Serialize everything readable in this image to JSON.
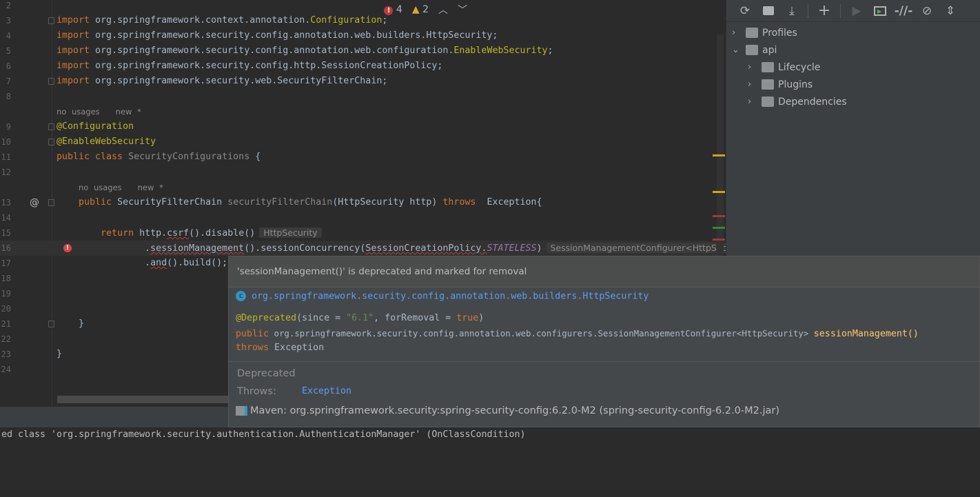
{
  "editor": {
    "lines": [
      {
        "n": "2",
        "tokens": []
      },
      {
        "n": "3",
        "fold": true,
        "tokens": [
          [
            "kw",
            "import "
          ],
          [
            "pl",
            "org.springframework.context.annotation."
          ],
          [
            "an",
            "Configuration"
          ],
          [
            "pl",
            ";"
          ]
        ]
      },
      {
        "n": "4",
        "tokens": [
          [
            "kw",
            "import "
          ],
          [
            "pl",
            "org.springframework.security.config.annotation.web.builders.HttpSecurity;"
          ]
        ]
      },
      {
        "n": "5",
        "tokens": [
          [
            "kw",
            "import "
          ],
          [
            "pl",
            "org.springframework.security.config.annotation.web.configuration."
          ],
          [
            "an",
            "EnableWebSecurity"
          ],
          [
            "pl",
            ";"
          ]
        ]
      },
      {
        "n": "6",
        "tokens": [
          [
            "kw",
            "import "
          ],
          [
            "pl",
            "org.springframework.security.config.http.SessionCreationPolicy;"
          ]
        ]
      },
      {
        "n": "7",
        "fold": true,
        "tokens": [
          [
            "kw",
            "import "
          ],
          [
            "pl",
            "org.springframework.security.web.SecurityFilterChain;"
          ]
        ]
      },
      {
        "n": "8",
        "tokens": []
      },
      {
        "inlay": "no usages   new *",
        "indent": 0
      },
      {
        "n": "9",
        "fold": true,
        "tokens": [
          [
            "an",
            "@Configuration"
          ]
        ]
      },
      {
        "n": "10",
        "fold": true,
        "tokens": [
          [
            "an",
            "@EnableWebSecurity"
          ]
        ]
      },
      {
        "n": "11",
        "tokens": [
          [
            "kw",
            "public class "
          ],
          [
            "gr",
            "SecurityConfigurations"
          ],
          [
            "pl",
            " {"
          ]
        ]
      },
      {
        "n": "12",
        "tokens": []
      },
      {
        "inlay": "no usages   new *",
        "indent": 4
      },
      {
        "n": "13",
        "fold": true,
        "gutter": "@",
        "tokens": [
          [
            "pl",
            "    "
          ],
          [
            "kw",
            "public "
          ],
          [
            "pl",
            "SecurityFilterChain "
          ],
          [
            "gr",
            "securityFilterChain"
          ],
          [
            "pl",
            "(HttpSecurity http) "
          ],
          [
            "kw",
            "throws "
          ],
          [
            "pl",
            " Exception{"
          ]
        ]
      },
      {
        "n": "14",
        "tokens": []
      },
      {
        "n": "15",
        "tokens": [
          [
            "pl",
            "        "
          ],
          [
            "kw",
            "return "
          ],
          [
            "pl",
            "http."
          ],
          [
            "err",
            "csrf"
          ],
          [
            "pl",
            "().disable()"
          ],
          [
            "hint",
            "HttpSecurity"
          ]
        ]
      },
      {
        "n": "16",
        "current": true,
        "bulb": true,
        "tokens": [
          [
            "pl",
            "                ."
          ],
          [
            "err",
            "sessionManagement"
          ],
          [
            "pl",
            "().sessionConcurrency("
          ],
          [
            "err",
            "SessionCreationPolicy."
          ],
          [
            "it",
            "STATELESS"
          ],
          [
            "pl",
            ")"
          ],
          [
            "hint",
            "SessionManagementConfigurer<HttpSecurity>"
          ]
        ]
      },
      {
        "n": "17",
        "tokens": [
          [
            "pl",
            "                ."
          ],
          [
            "err",
            "and"
          ],
          [
            "pl",
            "().build();"
          ]
        ]
      },
      {
        "n": "18",
        "tokens": []
      },
      {
        "n": "19",
        "tokens": []
      },
      {
        "n": "20",
        "tokens": []
      },
      {
        "n": "21",
        "fold": true,
        "tokens": [
          [
            "pl",
            "    }"
          ]
        ]
      },
      {
        "n": "22",
        "tokens": []
      },
      {
        "n": "23",
        "tokens": [
          [
            "pl",
            "}"
          ]
        ]
      },
      {
        "n": "24",
        "tokens": []
      }
    ],
    "errors_count": "4",
    "warnings_count": "2",
    "stripe_colors": [
      "#c9a227",
      "#c9a227",
      "#a33838",
      "#2e8b2e",
      "#a33838"
    ]
  },
  "maven_panel": {
    "toolbar": [
      "reload-icon",
      "generate-sources-icon",
      "download-icon",
      "add-icon",
      "run-icon",
      "execute-goal-icon",
      "toggle-offline-icon",
      "skip-tests-icon",
      "collapse-all-icon"
    ],
    "tree": [
      {
        "label": "Profiles",
        "expanded": false,
        "level": 0
      },
      {
        "label": "api",
        "expanded": true,
        "level": 0
      },
      {
        "label": "Lifecycle",
        "expanded": false,
        "level": 1
      },
      {
        "label": "Plugins",
        "expanded": false,
        "level": 1
      },
      {
        "label": "Dependencies",
        "expanded": false,
        "level": 1
      }
    ]
  },
  "tooltip": {
    "message": "'sessionManagement()' is deprecated and marked for removal",
    "class_fqn": "org.springframework.security.config.annotation.web.builders.HttpSecurity",
    "annotation": "@Deprecated",
    "annotation_args_open": "(since = ",
    "since_value": "\"6.1\"",
    "annotation_args_mid": ", forRemoval = ",
    "for_removal": "true",
    "annotation_args_close": ")",
    "sig_public": "public",
    "sig_type": " org.springframework.security.config.annotation.web.configurers.SessionManagementConfigurer<HttpSecurity> ",
    "sig_method": "sessionManagement()",
    "sig_throws": "throws",
    "sig_exception": " Exception",
    "deprecated_label": "Deprecated",
    "throws_label": "Throws:",
    "throws_value": "Exception",
    "library": "Maven: org.springframework.security:spring-security-config:6.2.0-M2 (spring-security-config-6.2.0-M2.jar)"
  },
  "console": {
    "line": "ed class 'org.springframework.security.authentication.AuthenticationManager' (OnClassCondition)"
  }
}
